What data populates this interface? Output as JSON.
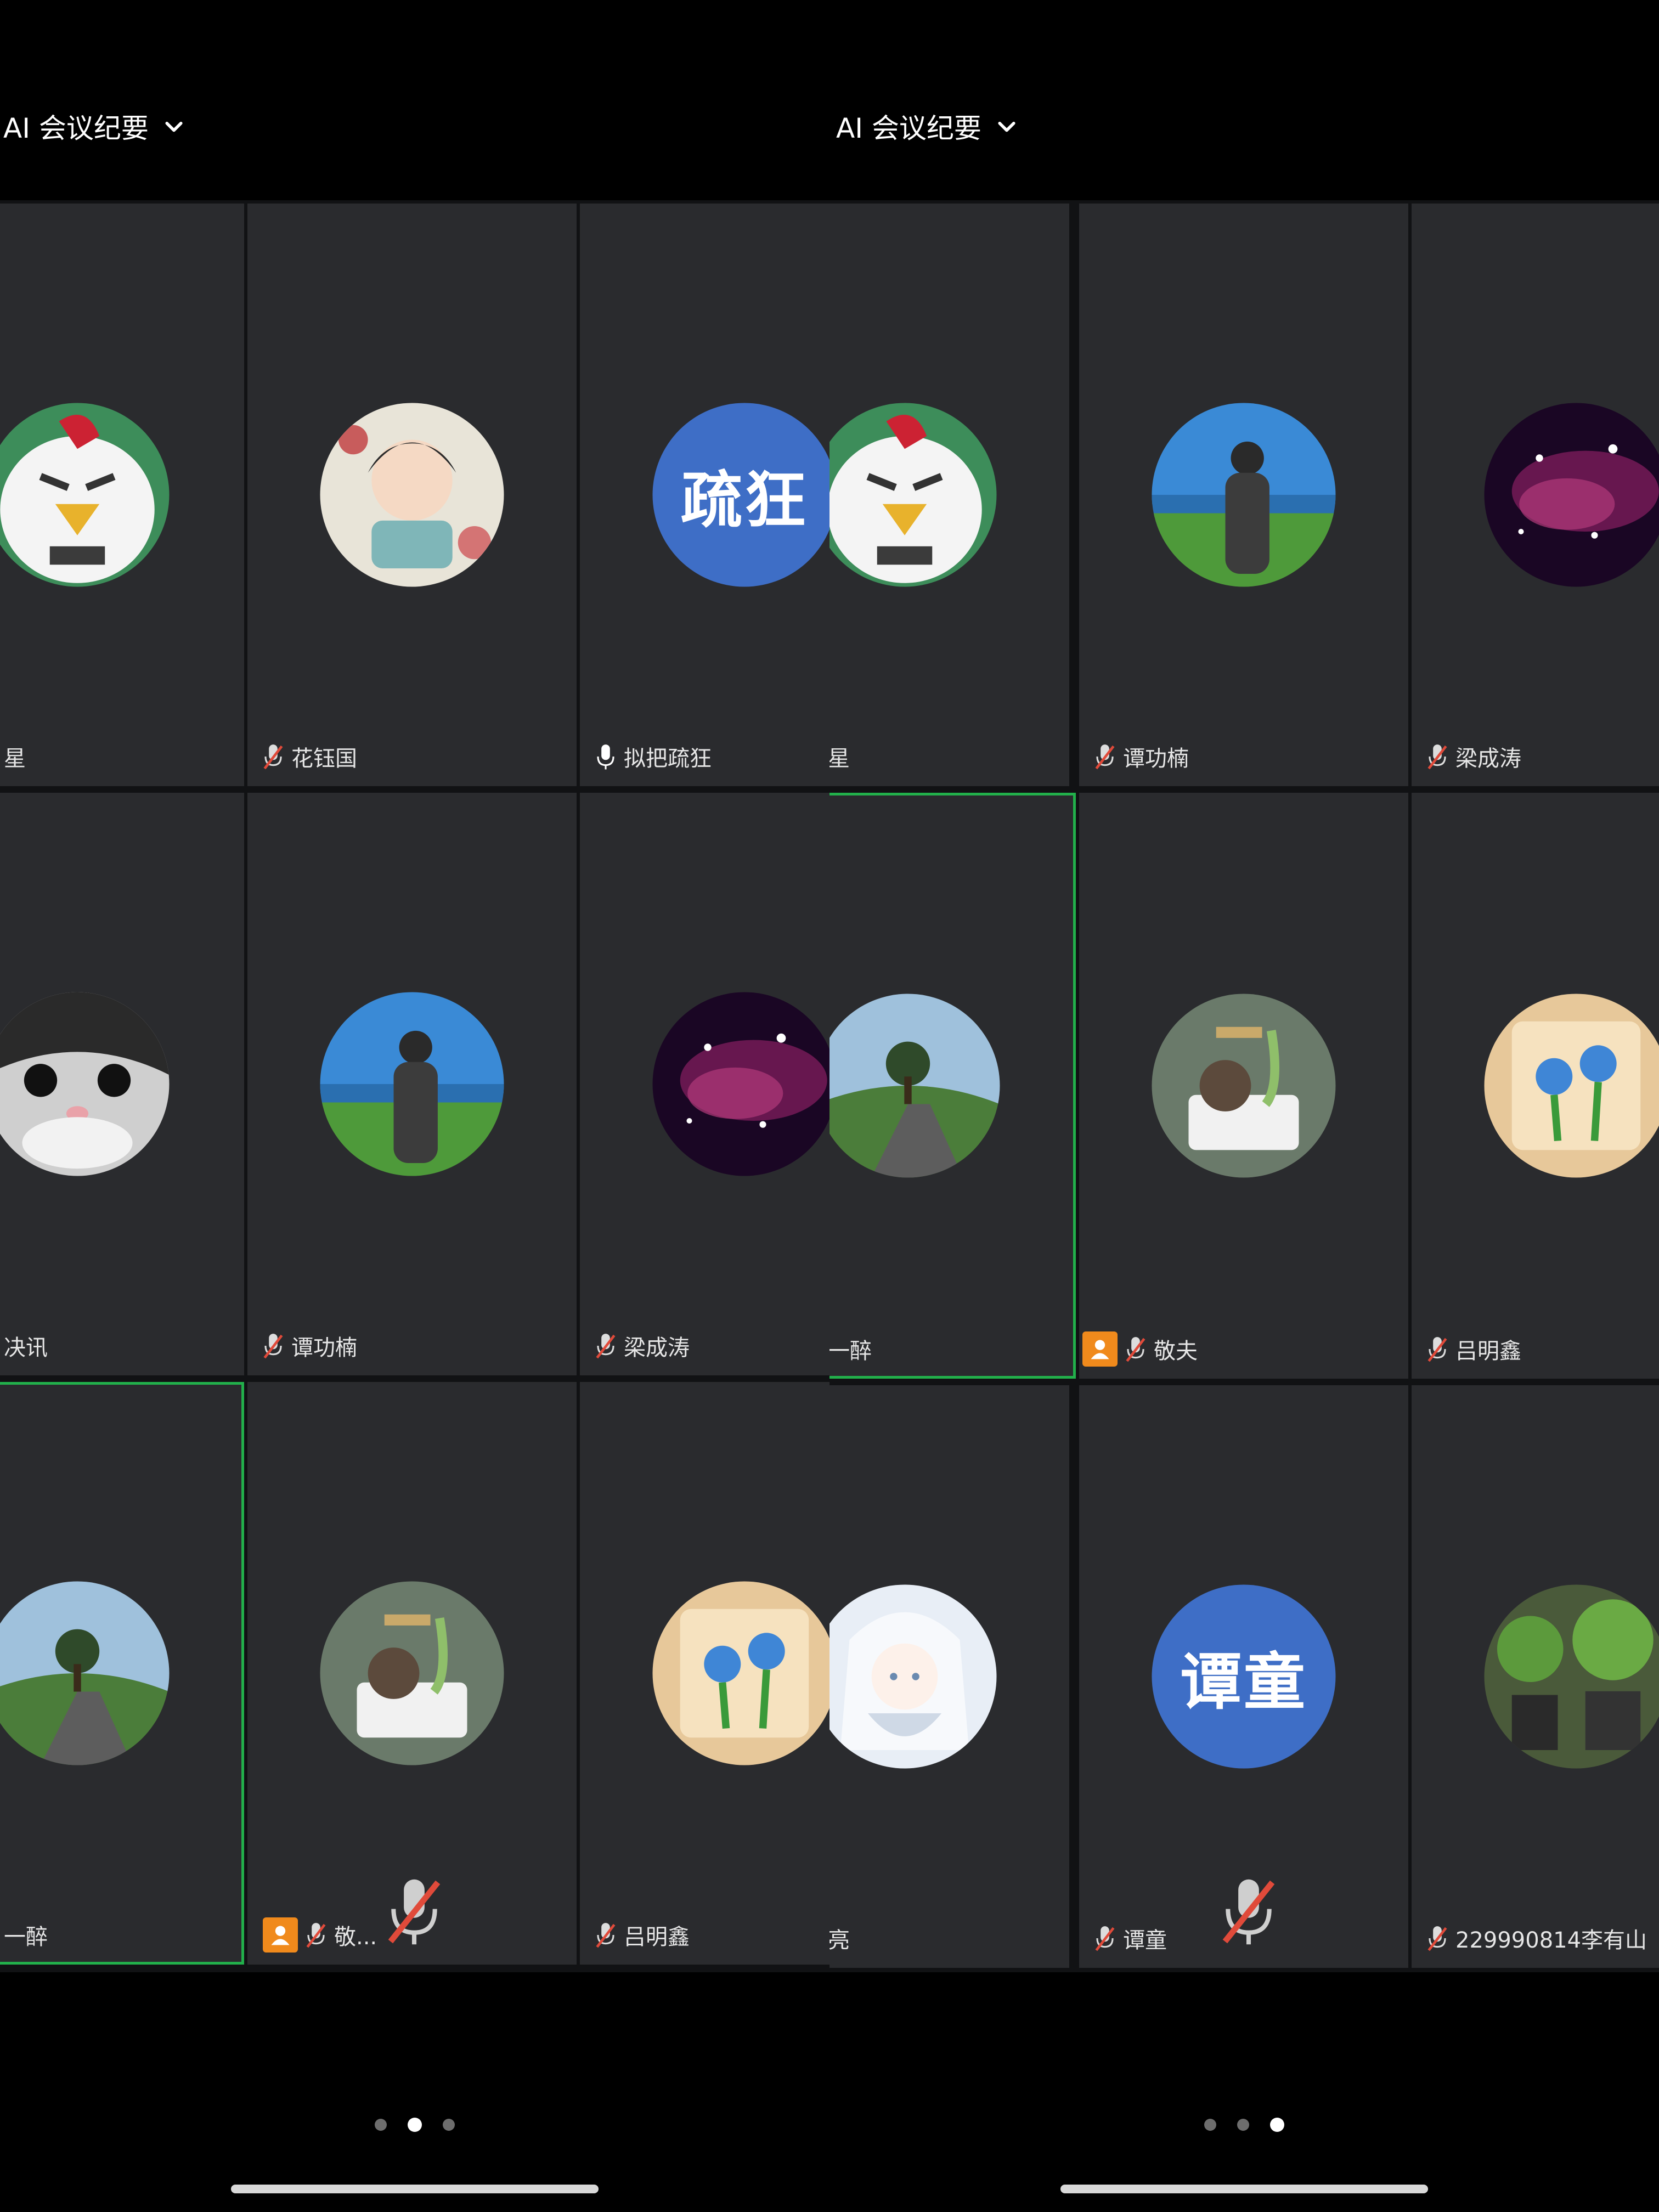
{
  "app": {
    "title": "AI 会议纪要"
  },
  "colors": {
    "active_border": "#22b04b",
    "host_badge": "#f08a1c",
    "text_avatar": "#3e6ec6",
    "tile_bg": "#2a2b2e"
  },
  "left": {
    "title": "AI 会议纪要",
    "pagination": {
      "pages": 3,
      "current": 2
    },
    "tiles": [
      {
        "label": "星",
        "avatar": "bird-mascot-icon",
        "mic": "muted",
        "host": false
      },
      {
        "label": "花钰国",
        "avatar": "anime-boy-icon",
        "mic": "muted",
        "host": false
      },
      {
        "label": "拟把疏狂",
        "avatar_text": "疏狂",
        "mic": "on",
        "host": false
      },
      {
        "label": "决讯",
        "avatar": "cat-face-icon",
        "mic": "muted",
        "host": false
      },
      {
        "label": "谭功楠",
        "avatar": "person-landscape-icon",
        "mic": "muted",
        "host": false
      },
      {
        "label": "梁成涛",
        "avatar": "galaxy-icon",
        "mic": "muted",
        "host": false
      },
      {
        "label": "一醉",
        "avatar": "tree-road-icon",
        "mic": "muted",
        "host": false,
        "active": true
      },
      {
        "label": "敬...",
        "avatar": "plant-pot-icon",
        "mic": "muted",
        "host": true
      },
      {
        "label": "吕明鑫",
        "avatar": "flower-card-icon",
        "mic": "muted",
        "host": false
      }
    ]
  },
  "right": {
    "title": "AI 会议纪要",
    "pagination": {
      "pages": 3,
      "current": 3
    },
    "tiles": [
      {
        "label": "星",
        "avatar": "bird-mascot-icon",
        "mic": "muted",
        "host": false
      },
      {
        "label": "谭功楠",
        "avatar": "person-landscape-icon",
        "mic": "muted",
        "host": false
      },
      {
        "label": "梁成涛",
        "avatar": "galaxy-icon",
        "mic": "muted",
        "host": false
      },
      {
        "label": "一醉",
        "avatar": "tree-road-icon",
        "mic": "muted",
        "host": false,
        "active": true
      },
      {
        "label": "敬夫",
        "avatar": "plant-pot-icon",
        "mic": "muted",
        "host": true
      },
      {
        "label": "吕明鑫",
        "avatar": "flower-card-icon",
        "mic": "muted",
        "host": false
      },
      {
        "label": "亮",
        "avatar": "anime-girl-icon",
        "mic": "muted",
        "host": false
      },
      {
        "label": "谭童",
        "avatar_text": "谭童",
        "mic": "muted",
        "host": false
      },
      {
        "label": "229990814李有山",
        "avatar": "plants-photo-icon",
        "mic": "muted",
        "host": false
      }
    ]
  }
}
